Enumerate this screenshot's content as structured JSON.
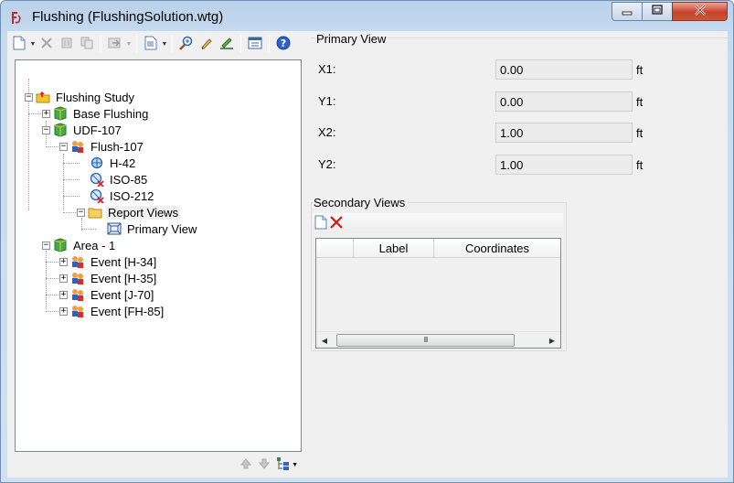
{
  "window": {
    "title": "Flushing (FlushingSolution.wtg)"
  },
  "tree": {
    "nodes": [
      {
        "label": "Flushing Study",
        "icon": "study-folder-icon"
      },
      {
        "label": "Base Flushing",
        "icon": "scenario-icon"
      },
      {
        "label": "UDF-107",
        "icon": "scenario-icon"
      },
      {
        "label": "Flush-107",
        "icon": "crew-icon"
      },
      {
        "label": "H-42",
        "icon": "hydrant-icon"
      },
      {
        "label": "ISO-85",
        "icon": "isolation-valve-icon"
      },
      {
        "label": "ISO-212",
        "icon": "isolation-valve-icon"
      },
      {
        "label": "Report Views",
        "icon": "folder-icon"
      },
      {
        "label": "Primary View",
        "icon": "view-icon"
      },
      {
        "label": "Area  - 1",
        "icon": "scenario-icon"
      },
      {
        "label": "Event [H-34]",
        "icon": "crew-icon"
      },
      {
        "label": "Event [H-35]",
        "icon": "crew-icon"
      },
      {
        "label": "Event [J-70]",
        "icon": "crew-icon"
      },
      {
        "label": "Event [FH-85]",
        "icon": "crew-icon"
      }
    ]
  },
  "primary_view": {
    "title": "Primary View",
    "fields": [
      {
        "label": "X1:",
        "value": "0.00",
        "unit": "ft"
      },
      {
        "label": "Y1:",
        "value": "0.00",
        "unit": "ft"
      },
      {
        "label": "X2:",
        "value": "1.00",
        "unit": "ft"
      },
      {
        "label": "Y2:",
        "value": "1.00",
        "unit": "ft"
      }
    ]
  },
  "secondary_views": {
    "title": "Secondary Views",
    "columns": [
      "",
      "Label",
      "Coordinates"
    ],
    "scroll_grip": "III"
  },
  "colors": {
    "title_bar": "#c7dbef",
    "close_button": "#c8402a",
    "panel_bg": "#f0f0f0"
  }
}
